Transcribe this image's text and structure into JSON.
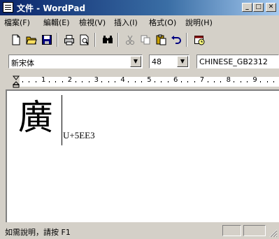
{
  "window": {
    "title": "文件 - WordPad",
    "min_glyph": "_",
    "max_glyph": "□",
    "close_glyph": "✕"
  },
  "menu": [
    "檔案(F)",
    "編輯(E)",
    "檢視(V)",
    "插入(I)",
    "格式(O)",
    "說明(H)"
  ],
  "toolbar": {
    "buttons": [
      "new-icon",
      "open-icon",
      "save-icon",
      "print-icon",
      "print-preview-icon",
      "find-icon",
      "cut-icon",
      "copy-icon",
      "paste-icon",
      "undo-icon",
      "date-time-icon"
    ]
  },
  "format": {
    "font": "新宋体",
    "size": "48",
    "script": "CHINESE_GB2312"
  },
  "ruler": {
    "labels": [
      "1",
      "2",
      "3",
      "4",
      "5",
      "6",
      "7",
      "8",
      "9"
    ]
  },
  "document": {
    "character": "廣",
    "codepoint": "U+5EE3"
  },
  "status": {
    "text": "如需說明，請按 F1"
  },
  "colors": {
    "titlebar_start": "#0a246a",
    "titlebar_end": "#a6caf0",
    "chrome": "#d4d0c8"
  }
}
